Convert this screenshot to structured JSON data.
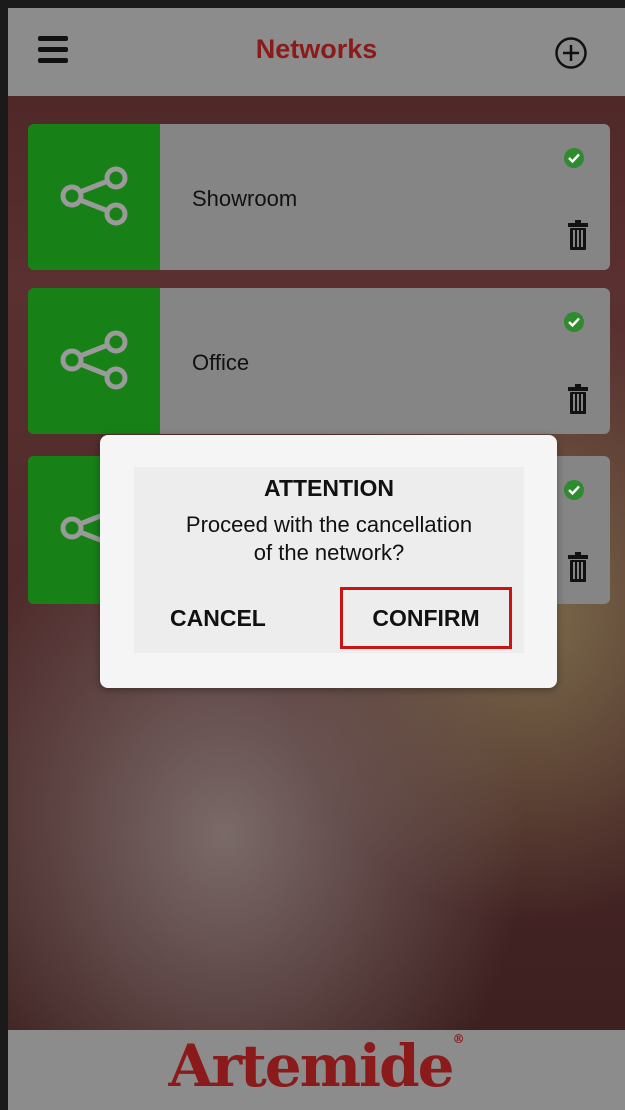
{
  "header": {
    "title": "Networks"
  },
  "networks": [
    {
      "name": "Showroom",
      "status": "active"
    },
    {
      "name": "Office",
      "status": "active"
    },
    {
      "name": "",
      "status": "active"
    }
  ],
  "dialog": {
    "title": "ATTENTION",
    "message_line1": "Proceed with the cancellation",
    "message_line2": "of the network?",
    "cancel_label": "CANCEL",
    "confirm_label": "CONFIRM"
  },
  "footer": {
    "brand": "Artemide",
    "registered": "®"
  },
  "colors": {
    "brand_red": "#8b1a1a",
    "network_green": "#178017",
    "status_green": "#2e8b2e",
    "highlight_red": "#c81414",
    "bar_gray": "#8c8c8c"
  }
}
